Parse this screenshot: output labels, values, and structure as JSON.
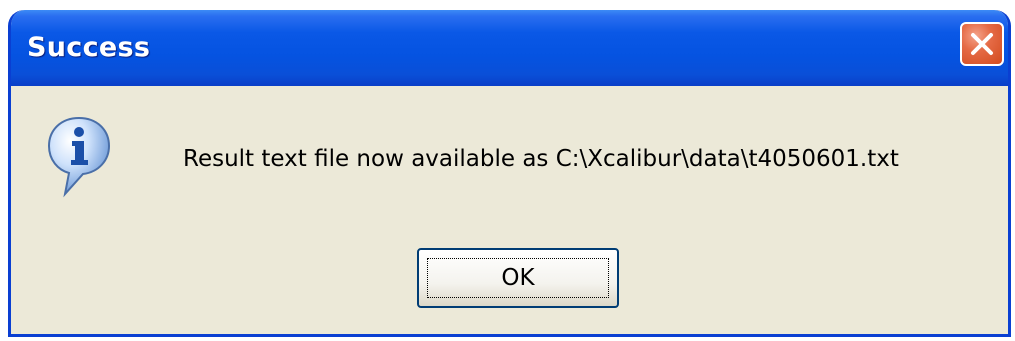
{
  "window": {
    "title": "Success",
    "close_icon": "close-icon"
  },
  "content": {
    "icon": "info-icon",
    "message": "Result text file now available as C:\\Xcalibur\\data\\t4050601.txt"
  },
  "buttons": {
    "ok_label": "OK"
  },
  "colors": {
    "titlebar": "#0553e1",
    "body": "#ece9d8",
    "close_button": "#d24a1e"
  }
}
